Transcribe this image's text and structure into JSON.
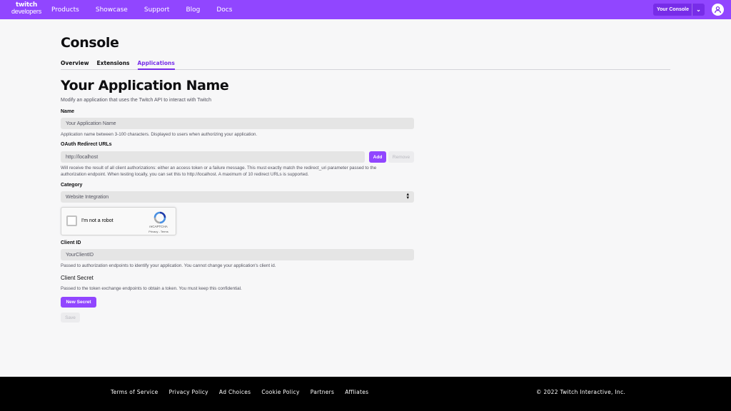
{
  "header": {
    "logo_line1": "twitch",
    "logo_line2": "developers",
    "nav": [
      "Products",
      "Showcase",
      "Support",
      "Blog",
      "Docs"
    ],
    "console_button": "Your Console",
    "caret": "⌄",
    "brand_color": "#9146ff"
  },
  "page": {
    "title": "Console",
    "tabs": [
      {
        "label": "Overview",
        "active": false
      },
      {
        "label": "Extensions",
        "active": false
      },
      {
        "label": "Applications",
        "active": true
      }
    ]
  },
  "form": {
    "title": "Your Application Name",
    "description": "Modify an application that uses the Twitch API to interact with Twitch",
    "name_label": "Name",
    "name_value": "Your Application Name",
    "name_help": "Application name between 3-100 characters. Displayed to users when authorizing your application.",
    "oauth_label": "OAuth Redirect URLs",
    "oauth_value": "http://localhost",
    "add_label": "Add",
    "remove_label": "Remove",
    "oauth_help_line1": "Will receive the result of all client authorizations: either an access token or a failure message. This must exactly match the redirect_uri parameter passed to the",
    "oauth_help_line2": "authorization endpoint. When testing locally, you can set this to http://localhost. A maximum of 10 redirect URLs is supported.",
    "category_label": "Category",
    "category_value": "Website Integration",
    "recaptcha_text": "I'm not a robot",
    "recaptcha_brand": "reCAPTCHA",
    "recaptcha_links": "Privacy - Terms",
    "client_id_label": "Client ID",
    "client_id_value": "YourClientID",
    "client_id_help": "Passed to authorization endpoints to identify your application. You cannot change your application's client id.",
    "client_secret_label": "Client Secret",
    "client_secret_help": "Passed to the token exchange endpoints to obtain a token. You must keep this confidential.",
    "new_secret_label": "New Secret",
    "save_label": "Save"
  },
  "footer": {
    "links": [
      "Terms of Service",
      "Privacy Policy",
      "Ad Choices",
      "Cookie Policy",
      "Partners",
      "Affliates"
    ],
    "copyright": "© 2022 Twitch Interactive, Inc."
  }
}
